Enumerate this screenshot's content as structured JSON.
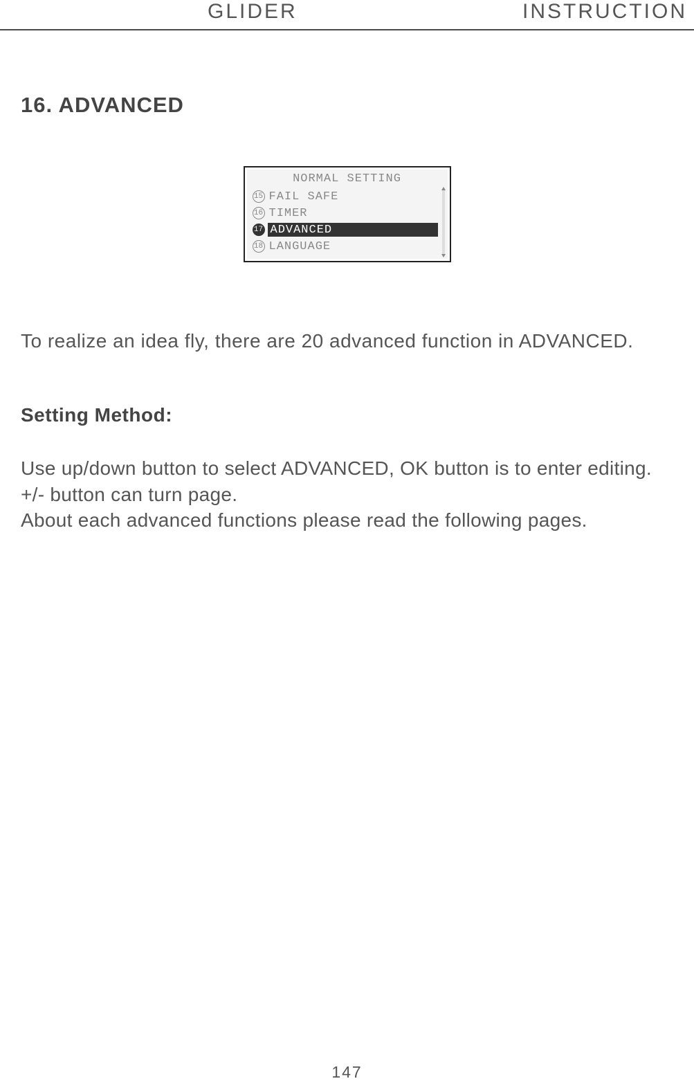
{
  "header": {
    "left": "GLIDER",
    "right": "INSTRUCTION"
  },
  "section_title": "16. ADVANCED",
  "lcd": {
    "title": "NORMAL SETTING",
    "items": [
      {
        "num": "15",
        "label": "FAIL SAFE",
        "selected": false
      },
      {
        "num": "16",
        "label": "TIMER",
        "selected": false
      },
      {
        "num": "17",
        "label": "ADVANCED",
        "selected": true
      },
      {
        "num": "18",
        "label": "LANGUAGE",
        "selected": false
      }
    ]
  },
  "intro_text": "To realize an idea fly, there are 20 advanced function in ADVANCED.",
  "subsection_title": "Setting Method:",
  "method_text_1": "Use up/down button to select ADVANCED, OK button is to enter editing. +/- button can turn page.",
  "method_text_2": "About each advanced functions please read the following pages.",
  "page_number": "147"
}
